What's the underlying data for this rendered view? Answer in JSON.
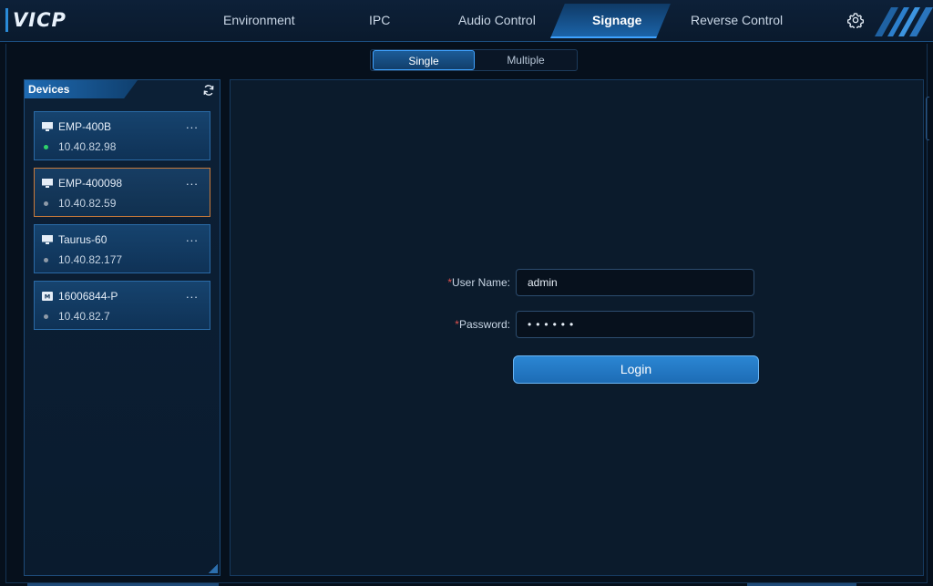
{
  "app": {
    "logo": "VICP"
  },
  "nav": {
    "items": [
      {
        "label": "Environment"
      },
      {
        "label": "IPC"
      },
      {
        "label": "Audio Control"
      },
      {
        "label": "Signage"
      },
      {
        "label": "Reverse Control"
      }
    ],
    "active": "Signage",
    "settings_icon": "gear-icon"
  },
  "mode_tabs": {
    "single": "Single",
    "multiple": "Multiple",
    "active": "Single"
  },
  "devices": {
    "title": "Devices",
    "refresh_icon": "refresh-icon",
    "items": [
      {
        "name": "EMP-400B",
        "ip": "10.40.82.98",
        "status_color": "#2fd36b",
        "icon": "monitor-icon",
        "more": "..."
      },
      {
        "name": "EMP-400098",
        "ip": "10.40.82.59",
        "status_color": "#8e9aa8",
        "icon": "monitor-icon",
        "more": "..."
      },
      {
        "name": "Taurus-60",
        "ip": "10.40.82.177",
        "status_color": "#8e9aa8",
        "icon": "monitor-icon",
        "more": "..."
      },
      {
        "name": "16006844-P",
        "ip": "10.40.82.7",
        "status_color": "#8e9aa8",
        "icon": "player-icon",
        "more": "..."
      }
    ],
    "selected_index": 1
  },
  "login_form": {
    "required_mark": "*",
    "username_label": "User Name:",
    "username_value": "admin",
    "password_label": "Password:",
    "password_value": "••••••",
    "login_button": "Login"
  },
  "colors": {
    "accent": "#3fa2ff",
    "selected_border": "#c97a3a",
    "required": "#e0524f"
  }
}
